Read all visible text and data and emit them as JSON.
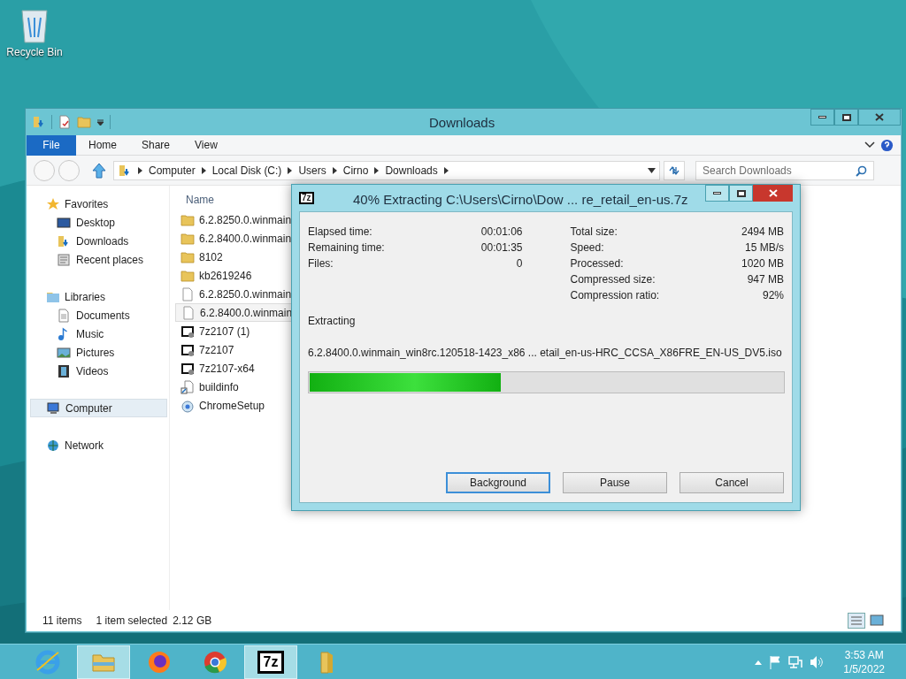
{
  "desktop": {
    "icons": [
      {
        "label": "Recycle Bin"
      }
    ]
  },
  "explorer": {
    "title": "Downloads",
    "ribbon_tabs": [
      {
        "label": "File",
        "kind": "file",
        "selected": false
      },
      {
        "label": "Home",
        "kind": "tab",
        "selected": false
      },
      {
        "label": "Share",
        "kind": "tab",
        "selected": false
      },
      {
        "label": "View",
        "kind": "tab",
        "selected": false
      }
    ],
    "address": [
      "Computer",
      "Local Disk (C:)",
      "Users",
      "Cirno",
      "Downloads"
    ],
    "search": {
      "placeholder": "Search Downloads"
    },
    "nav": [
      {
        "label": "Favorites",
        "kind": "star",
        "selected": false,
        "children": [
          {
            "label": "Desktop",
            "kind": "desktop",
            "selected": false
          },
          {
            "label": "Downloads",
            "kind": "downloads",
            "selected": false
          },
          {
            "label": "Recent places",
            "kind": "recent",
            "selected": false
          }
        ]
      },
      {
        "label": "Libraries",
        "kind": "library",
        "selected": false,
        "children": [
          {
            "label": "Documents",
            "kind": "documents",
            "selected": false
          },
          {
            "label": "Music",
            "kind": "music",
            "selected": false
          },
          {
            "label": "Pictures",
            "kind": "pictures",
            "selected": false
          },
          {
            "label": "Videos",
            "kind": "videos",
            "selected": false
          }
        ]
      },
      {
        "label": "Computer",
        "kind": "computer",
        "selected": true
      },
      {
        "label": "Network",
        "kind": "network",
        "selected": false
      }
    ],
    "column": "Name",
    "files": [
      {
        "name": "6.2.8250.0.winmain",
        "kind": "folder",
        "selected": false
      },
      {
        "name": "6.2.8400.0.winmain",
        "kind": "folder",
        "selected": false
      },
      {
        "name": "8102",
        "kind": "folder",
        "selected": false
      },
      {
        "name": "kb2619246",
        "kind": "folder",
        "selected": false
      },
      {
        "name": "6.2.8250.0.winmain",
        "kind": "file",
        "selected": false
      },
      {
        "name": "6.2.8400.0.winmain",
        "kind": "file",
        "selected": true
      },
      {
        "name": "7z2107 (1)",
        "kind": "archive",
        "selected": false
      },
      {
        "name": "7z2107",
        "kind": "archive",
        "selected": false
      },
      {
        "name": "7z2107-x64",
        "kind": "archive",
        "selected": false
      },
      {
        "name": "buildinfo",
        "kind": "shortcut",
        "selected": false
      },
      {
        "name": "ChromeSetup",
        "kind": "setup",
        "selected": false
      }
    ],
    "status": [
      "11 items",
      "1 item selected",
      "2.12 GB"
    ]
  },
  "dialog": {
    "icon_text": "7z",
    "title": "40% Extracting C:\\Users\\Cirno\\Dow ... re_retail_en-us.7z",
    "left_stats": [
      {
        "label": "Elapsed time:",
        "value": "00:01:06"
      },
      {
        "label": "Remaining time:",
        "value": "00:01:35"
      },
      {
        "label": "Files:",
        "value": "0"
      }
    ],
    "right_stats": [
      {
        "label": "Total size:",
        "value": "2494 MB"
      },
      {
        "label": "Speed:",
        "value": "15 MB/s"
      },
      {
        "label": "Processed:",
        "value": "1020 MB"
      },
      {
        "label": "Compressed size:",
        "value": "947 MB"
      },
      {
        "label": "Compression ratio:",
        "value": "92%"
      }
    ],
    "operation": "Extracting",
    "current_file": "6.2.8400.0.winmain_win8rc.120518-1423_x86 ... etail_en-us-HRC_CCSA_X86FRE_EN-US_DV5.iso",
    "progress": {
      "level": 0.404
    },
    "buttons": [
      {
        "label": "Background",
        "default": true
      },
      {
        "label": "Pause",
        "default": false
      },
      {
        "label": "Cancel",
        "default": false
      }
    ]
  },
  "taskbar": {
    "apps": [
      {
        "kind": "ie",
        "active": false
      },
      {
        "kind": "explorer",
        "active": true
      },
      {
        "kind": "firefox",
        "active": false
      },
      {
        "kind": "chrome",
        "active": false
      },
      {
        "kind": "sevenzip",
        "active": true,
        "text": "7z"
      },
      {
        "kind": "folder",
        "active": false
      }
    ],
    "time": "3:53 AM",
    "date": "1/5/2022"
  }
}
